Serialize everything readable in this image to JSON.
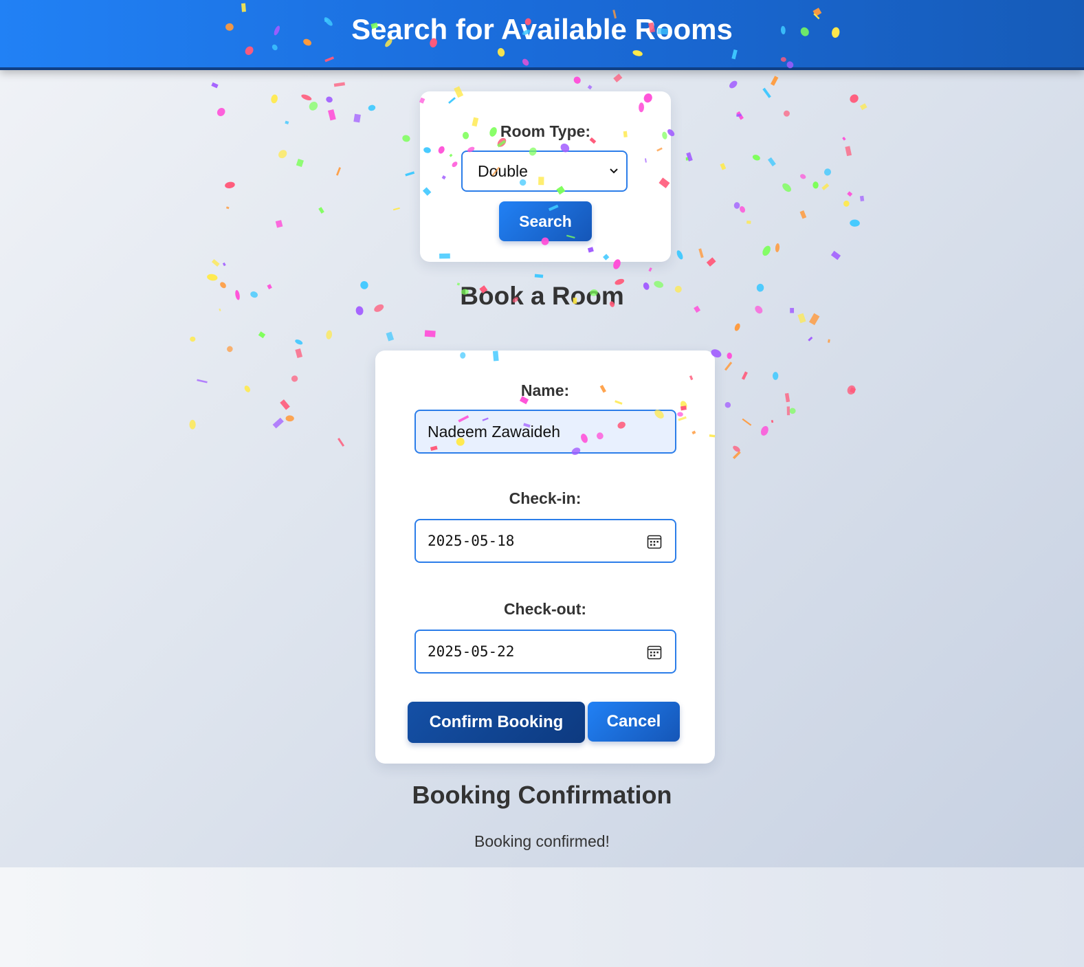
{
  "header": {
    "title": "Search for Available Rooms"
  },
  "search": {
    "room_type_label": "Room Type:",
    "room_type_value": "Double",
    "search_button": "Search"
  },
  "booking": {
    "heading": "Book a Room",
    "name_label": "Name:",
    "name_value": "Nadeem Zawaideh",
    "checkin_label": "Check-in:",
    "checkin_value": "2025-05-18",
    "checkout_label": "Check-out:",
    "checkout_value": "2025-05-22",
    "confirm_button": "Confirm Booking",
    "cancel_button": "Cancel"
  },
  "confirmation": {
    "heading": "Booking Confirmation",
    "message": "Booking confirmed!"
  },
  "colors": {
    "accent": "#2181f5",
    "accent_dark": "#165bb8",
    "confirm": "#0d3a80",
    "text": "#333333"
  },
  "icons": [
    "chevron-down-icon",
    "calendar-icon"
  ]
}
